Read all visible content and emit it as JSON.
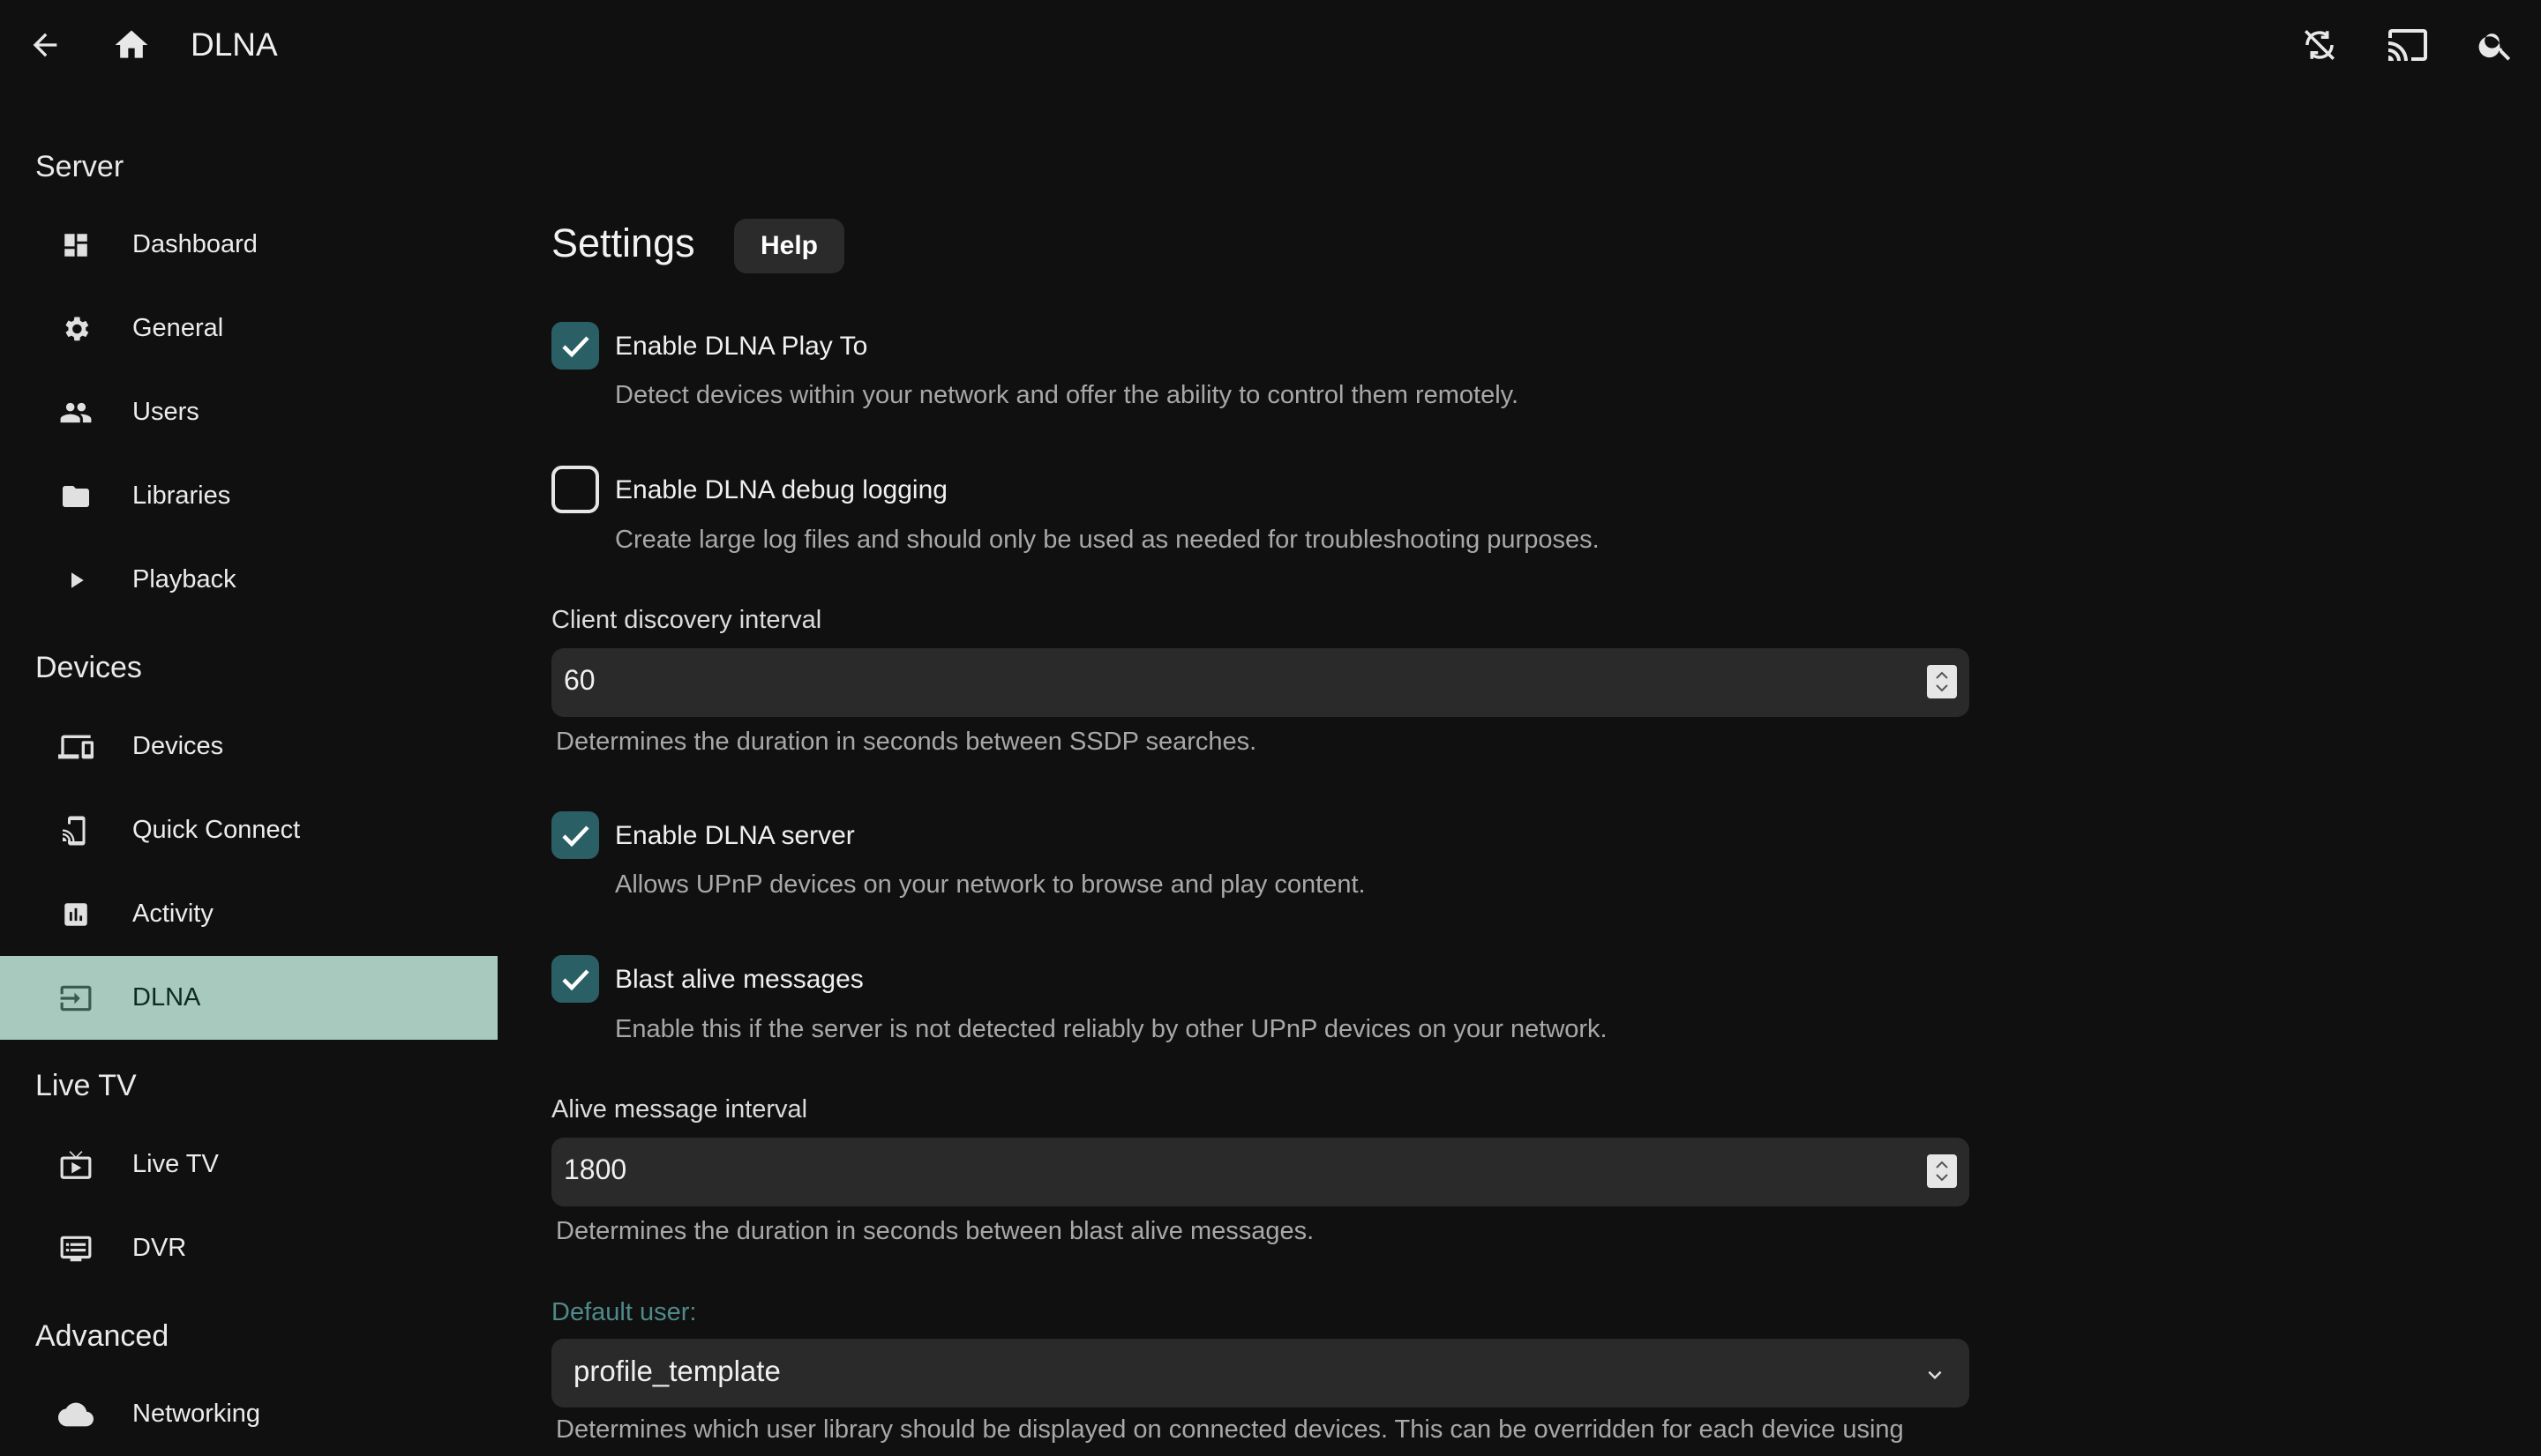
{
  "header": {
    "title": "DLNA"
  },
  "sidebar": {
    "sections": [
      {
        "title": "Server",
        "items": [
          {
            "label": "Dashboard",
            "icon": "dashboard-icon"
          },
          {
            "label": "General",
            "icon": "gear-icon"
          },
          {
            "label": "Users",
            "icon": "people-icon"
          },
          {
            "label": "Libraries",
            "icon": "folder-icon"
          },
          {
            "label": "Playback",
            "icon": "play-icon"
          }
        ]
      },
      {
        "title": "Devices",
        "items": [
          {
            "label": "Devices",
            "icon": "devices-icon"
          },
          {
            "label": "Quick Connect",
            "icon": "phone-cast-icon"
          },
          {
            "label": "Activity",
            "icon": "chart-icon"
          },
          {
            "label": "DLNA",
            "icon": "input-icon",
            "active": true
          }
        ]
      },
      {
        "title": "Live TV",
        "items": [
          {
            "label": "Live TV",
            "icon": "live-tv-icon"
          },
          {
            "label": "DVR",
            "icon": "dvr-icon"
          }
        ]
      },
      {
        "title": "Advanced",
        "items": [
          {
            "label": "Networking",
            "icon": "cloud-icon"
          }
        ]
      }
    ]
  },
  "main": {
    "title": "Settings",
    "help_label": "Help",
    "play_to": {
      "checked": true,
      "label": "Enable DLNA Play To",
      "desc": "Detect devices within your network and offer the ability to control them remotely."
    },
    "debug": {
      "checked": false,
      "label": "Enable DLNA debug logging",
      "desc": "Create large log files and should only be used as needed for troubleshooting purposes."
    },
    "discovery": {
      "label": "Client discovery interval",
      "value": "60",
      "desc": "Determines the duration in seconds between SSDP searches."
    },
    "server": {
      "checked": true,
      "label": "Enable DLNA server",
      "desc": "Allows UPnP devices on your network to browse and play content."
    },
    "blast": {
      "checked": true,
      "label": "Blast alive messages",
      "desc": "Enable this if the server is not detected reliably by other UPnP devices on your network."
    },
    "alive_interval": {
      "label": "Alive message interval",
      "value": "1800",
      "desc": "Determines the duration in seconds between blast alive messages."
    },
    "default_user": {
      "label": "Default user:",
      "value": "profile_template",
      "desc": "Determines which user library should be displayed on connected devices. This can be overridden for each device using"
    }
  },
  "colors": {
    "accent": "#a8c9bd",
    "checkbox": "#2b5f66",
    "select_label": "#4f8a8a",
    "background": "#101010"
  }
}
